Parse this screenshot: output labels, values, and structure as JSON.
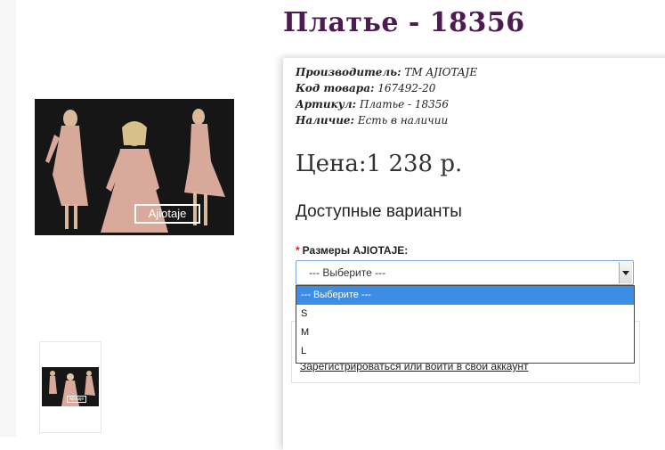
{
  "product": {
    "title": "Платье - 18356",
    "photo_brand": "Ajiotaje",
    "thumb_brand": "Ajiotaje"
  },
  "meta": {
    "manufacturer_label": "Производитель:",
    "manufacturer_value": "ТМ AJIOTAJE",
    "code_label": "Код товара:",
    "code_value": "167492-20",
    "article_label": "Артикул:",
    "article_value": "Платье - 18356",
    "availability_label": "Наличие:",
    "availability_value": "Есть в наличии"
  },
  "price": {
    "label": "Цена:",
    "value": "1 238 р."
  },
  "variants": {
    "heading": "Доступные варианты",
    "size_required": "*",
    "size_label": "Размеры AJIOTAJE:",
    "selected": "--- Выберите ---",
    "options": [
      "--- Выберите ---",
      "S",
      "M",
      "L"
    ]
  },
  "account": {
    "link_text": "Зарегистрироваться или войти в свой аккаунт"
  },
  "colors": {
    "title": "#4e1a52",
    "selected_option": "#3b8ee4",
    "required": "#dd2222"
  }
}
